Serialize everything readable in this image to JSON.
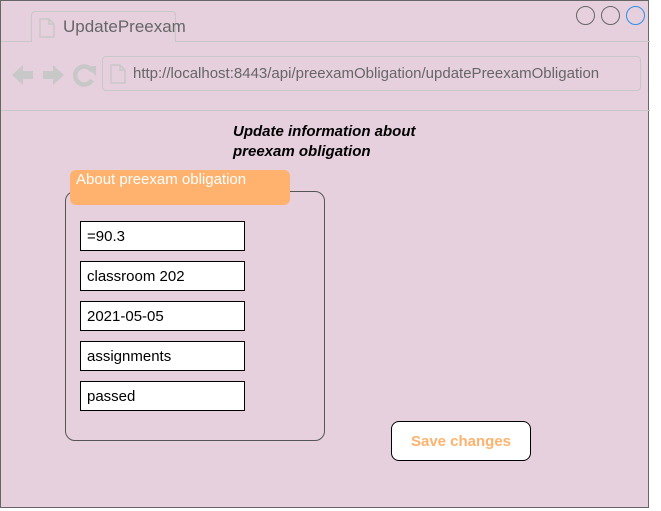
{
  "browser": {
    "tab_title": "UpdatePreexam",
    "url": "http://localhost:8443/api/preexamObligation/updatePreexamObligation",
    "icons": [
      "document-icon",
      "back-arrow-icon",
      "forward-arrow-icon",
      "refresh-icon",
      "minimize-circle-icon",
      "maximize-circle-icon",
      "close-circle-icon"
    ]
  },
  "page": {
    "heading": "Update information about preexam obligation",
    "section_title": "About preexam obligation",
    "fields": [
      {
        "value": "=90.3"
      },
      {
        "value": "classroom 202"
      },
      {
        "value": "2021-05-05"
      },
      {
        "value": "assignments"
      },
      {
        "value": "passed"
      }
    ],
    "save_label": "Save changes"
  },
  "colors": {
    "page_background": "#e6d0de",
    "accent_orange": "#ffb26e",
    "window_active_button": "#2e8fe6",
    "chrome_gray": "#c8c8c8"
  }
}
